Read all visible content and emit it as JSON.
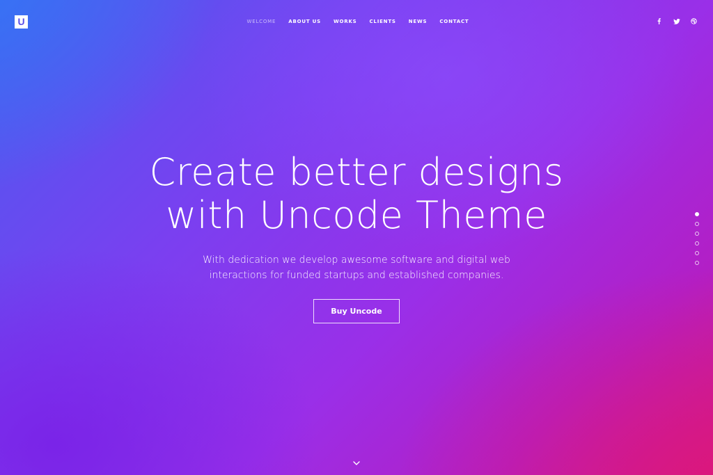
{
  "brand": {
    "logo_letter": "U"
  },
  "nav": {
    "items": [
      {
        "label": "WELCOME",
        "active": true
      },
      {
        "label": "ABOUT US",
        "active": false
      },
      {
        "label": "WORKS",
        "active": false
      },
      {
        "label": "CLIENTS",
        "active": false
      },
      {
        "label": "NEWS",
        "active": false
      },
      {
        "label": "CONTACT",
        "active": false
      }
    ]
  },
  "social": {
    "icons": [
      "facebook-icon",
      "twitter-icon",
      "dribbble-icon"
    ]
  },
  "hero": {
    "title_line1": "Create better designs",
    "title_line2": "with Uncode Theme",
    "subtitle_line1": "With dedication we develop awesome software and digital web",
    "subtitle_line2": "interactions for funded startups and established companies.",
    "cta_label": "Buy Uncode"
  },
  "pagination": {
    "total": 6,
    "active_index": 0
  },
  "colors": {
    "gradient_top_left": "#3a7af2",
    "gradient_center": "#8a3bf0",
    "gradient_bottom_right": "#d41a88",
    "text": "#ffffff"
  }
}
